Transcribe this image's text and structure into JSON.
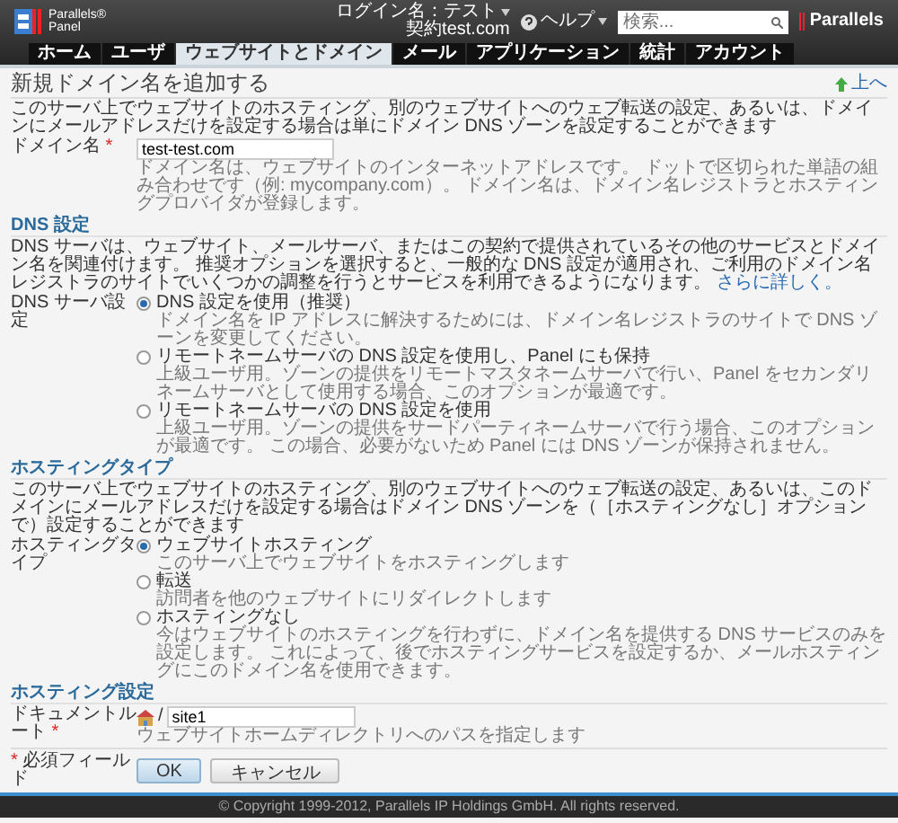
{
  "header": {
    "logo": {
      "brand": "Parallels®",
      "product": "Panel"
    },
    "login": {
      "label": "ログイン名：テスト",
      "account": "契約test.com"
    },
    "help": "ヘルプ",
    "search": {
      "placeholder": "検索..."
    },
    "brand": "Parallels"
  },
  "tabs": [
    {
      "label": "ホーム",
      "selected": false
    },
    {
      "label": "ユーザ",
      "selected": false
    },
    {
      "label": "ウェブサイトとドメイン",
      "selected": true
    },
    {
      "label": "メール",
      "selected": false
    },
    {
      "label": "アプリケーション",
      "selected": false
    },
    {
      "label": "統計",
      "selected": false
    },
    {
      "label": "アカウント",
      "selected": false
    }
  ],
  "page": {
    "title": "新規ドメイン名を追加する",
    "up_link": "上へ"
  },
  "intro": "このサーバ上でウェブサイトのホスティング、別のウェブサイトへのウェブ転送の設定、あるいは、ドメインにメールアドレスだけを設定する場合は単にドメイン DNS ゾーンを設定することができます",
  "domain_field": {
    "label": "ドメイン名",
    "required_mark": "*",
    "value": "test-test.com",
    "hint": "ドメイン名は、ウェブサイトのインターネットアドレスです。 ドットで区切られた単語の組み合わせです（例: mycompany.com）。 ドメイン名は、ドメイン名レジストラとホスティングプロバイダが登録します。"
  },
  "sections": [
    {
      "heading": "DNS 設定",
      "description": "DNS サーバは、ウェブサイト、メールサーバ、またはこの契約で提供されているその他のサービスとドメイン名を関連付けます。 推奨オプションを選択すると、一般的な DNS 設定が適用され、ご利用のドメイン名レジストラのサイトでいくつかの調整を行うとサービスを利用できるようになります。",
      "link": "さらに詳しく。",
      "field": {
        "label": "DNS サーバ設定",
        "options": [
          {
            "label": "DNS 設定を使用（推奨）",
            "description": "ドメイン名を IP アドレスに解決するためには、ドメイン名レジストラのサイトで DNS ゾーンを変更してください。",
            "selected": true
          },
          {
            "label": "リモートネームサーバの DNS 設定を使用し、Panel にも保持",
            "description": "上級ユーザ用。ゾーンの提供をリモートマスタネームサーバで行い、Panel をセカンダリネームサーバとして使用する場合、このオプションが最適です。",
            "selected": false
          },
          {
            "label": "リモートネームサーバの DNS 設定を使用",
            "description": "上級ユーザ用。ゾーンの提供をサードパーティネームサーバで行う場合、このオプションが最適です。 この場合、必要がないため Panel には DNS ゾーンが保持されません。",
            "selected": false
          }
        ]
      }
    },
    {
      "heading": "ホスティングタイプ",
      "description": "このサーバ上でウェブサイトのホスティング、別のウェブサイトへのウェブ転送の設定、あるいは、このドメインにメールアドレスだけを設定する場合はドメイン DNS ゾーンを（［ホスティングなし］オプションで）設定することができます",
      "field": {
        "label": "ホスティングタイプ",
        "options": [
          {
            "label": "ウェブサイトホスティング",
            "description": "このサーバ上でウェブサイトをホスティングします",
            "selected": true
          },
          {
            "label": "転送",
            "description": "訪問者を他のウェブサイトにリダイレクトします",
            "selected": false
          },
          {
            "label": "ホスティングなし",
            "description": "今はウェブサイトのホスティングを行わずに、ドメイン名を提供する DNS サービスのみを設定します。 これによって、後でホスティングサービスを設定するか、メールホスティングにこのドメイン名を使用できます。",
            "selected": false
          }
        ]
      }
    }
  ],
  "hosting_settings": {
    "heading": "ホスティング設定",
    "document_root": {
      "label": "ドキュメントルート",
      "required_mark": "*",
      "prefix": "/",
      "value": "site1",
      "hint": "ウェブサイトホームディレクトリへのパスを指定します"
    }
  },
  "form_footer": {
    "required_mark": "*",
    "required_note": "必須フィールド",
    "buttons": [
      {
        "label": "OK",
        "kind": "primary"
      },
      {
        "label": "キャンセル",
        "kind": "secondary"
      }
    ]
  },
  "copyright": "© Copyright 1999-2012, Parallels IP Holdings GmbH. All rights reserved."
}
